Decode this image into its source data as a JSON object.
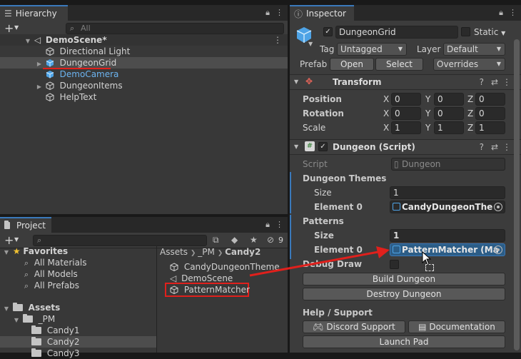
{
  "hierarchy": {
    "tab_label": "Hierarchy",
    "add_label": "+",
    "search_placeholder": "All",
    "scene": "DemoScene*",
    "items": [
      {
        "label": "Directional Light"
      },
      {
        "label": "DungeonGrid"
      },
      {
        "label": "DemoCamera"
      },
      {
        "label": "DungeonItems"
      },
      {
        "label": "HelpText"
      }
    ]
  },
  "project": {
    "tab_label": "Project",
    "add_label": "+",
    "hidden_count": "9",
    "favorites_label": "Favorites",
    "favorites": [
      {
        "label": "All Materials"
      },
      {
        "label": "All Models"
      },
      {
        "label": "All Prefabs"
      }
    ],
    "assets_label": "Assets",
    "tree": [
      {
        "label": "_PM"
      },
      {
        "label": "Candy1"
      },
      {
        "label": "Candy2"
      },
      {
        "label": "Candy3"
      }
    ],
    "breadcrumb": [
      "Assets",
      "_PM",
      "Candy2"
    ],
    "files": [
      {
        "label": "CandyDungeonTheme"
      },
      {
        "label": "DemoScene"
      },
      {
        "label": "PatternMatcher"
      }
    ]
  },
  "inspector": {
    "tab_label": "Inspector",
    "object_name": "DungeonGrid",
    "static_label": "Static",
    "tag_label": "Tag",
    "tag_value": "Untagged",
    "layer_label": "Layer",
    "layer_value": "Default",
    "prefab_label": "Prefab",
    "open_label": "Open",
    "select_label": "Select",
    "overrides_label": "Overrides",
    "transform": {
      "title": "Transform",
      "rows": [
        {
          "label": "Position",
          "x": "0",
          "y": "0",
          "z": "0"
        },
        {
          "label": "Rotation",
          "x": "0",
          "y": "0",
          "z": "0"
        },
        {
          "label": "Scale",
          "x": "1",
          "y": "1",
          "z": "1"
        }
      ],
      "axis_x": "X",
      "axis_y": "Y",
      "axis_z": "Z"
    },
    "script_component": {
      "title": "Dungeon (Script)",
      "script_label": "Script",
      "script_value": "Dungeon",
      "themes_label": "Dungeon Themes",
      "themes_size_label": "Size",
      "themes_size": "1",
      "themes_el_label": "Element 0",
      "themes_el_value": "CandyDungeonThe",
      "patterns_label": "Patterns",
      "patterns_size_label": "Size",
      "patterns_size": "1",
      "patterns_el_label": "Element 0",
      "patterns_el_value": "PatternMatcher (Ma",
      "debug_label": "Debug Draw",
      "build_label": "Build Dungeon",
      "destroy_label": "Destroy Dungeon",
      "help_label": "Help / Support",
      "discord_label": "Discord Support",
      "docs_label": "Documentation",
      "launch_label": "Launch Pad"
    }
  },
  "colors": {
    "accent": "#3a79bb",
    "annotation": "#e0201c",
    "selection": "#2c5d87"
  }
}
